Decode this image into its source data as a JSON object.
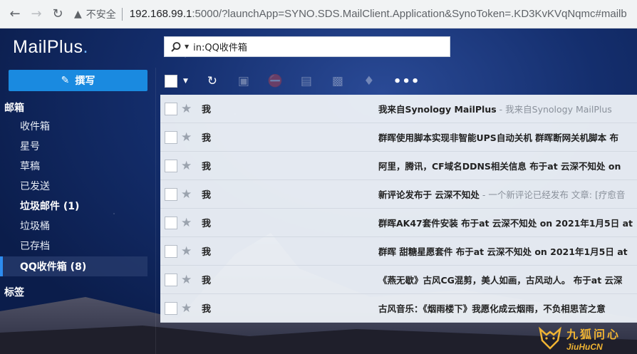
{
  "browser": {
    "insecure_label": "不安全",
    "url_host": "192.168.99.1",
    "url_rest": ":5000/?launchApp=SYNO.SDS.MailClient.Application&SynoToken=.KD3KvKVqNqmc#mailb"
  },
  "app": {
    "logo_text": "MailPlus",
    "search_value": "in:QQ收件箱"
  },
  "sidebar": {
    "compose_label": "撰写",
    "mailbox_section": "邮箱",
    "mailboxes": [
      {
        "label": "收件箱"
      },
      {
        "label": "星号"
      },
      {
        "label": "草稿"
      },
      {
        "label": "已发送"
      },
      {
        "label": "垃圾邮件 (1)"
      },
      {
        "label": "垃圾桶"
      },
      {
        "label": "已存档"
      },
      {
        "label": "QQ收件箱 (8)"
      }
    ],
    "tags_section": "标签"
  },
  "toolbar": {
    "icons": [
      "refresh-icon",
      "archive-icon",
      "block-icon",
      "trash-icon",
      "folder-icon",
      "tag-icon"
    ],
    "more_label": "•••"
  },
  "mails": [
    {
      "sender": "我",
      "subject": "我来自Synology MailPlus",
      "preview": " - 我来自Synology MailPlus"
    },
    {
      "sender": "我",
      "subject": "群晖使用脚本实现非智能UPS自动关机 群晖断网关机脚本 布",
      "preview": ""
    },
    {
      "sender": "我",
      "subject": "阿里，腾讯，CF域名DDNS相关信息 布于at 云深不知处 on",
      "preview": ""
    },
    {
      "sender": "我",
      "subject": "新评论发布于 云深不知处",
      "preview": " - 一个新评论已经发布 文章: [疗愈音"
    },
    {
      "sender": "我",
      "subject": "群晖AK47套件安装 布于at 云深不知处 on 2021年1月5日 at",
      "preview": ""
    },
    {
      "sender": "我",
      "subject": "群晖 甜糖星愿套件 布于at 云深不知处 on 2021年1月5日 at",
      "preview": ""
    },
    {
      "sender": "我",
      "subject": "《燕无歇》古风CG混剪，美人如画，古风动人。 布于at 云深",
      "preview": ""
    },
    {
      "sender": "我",
      "subject": "古风音乐：《烟雨楼下》我愿化成云烟雨，不负相思苦之意",
      "preview": ""
    }
  ],
  "watermark": {
    "cn": "九狐问心",
    "en": "JiuHuCN"
  }
}
